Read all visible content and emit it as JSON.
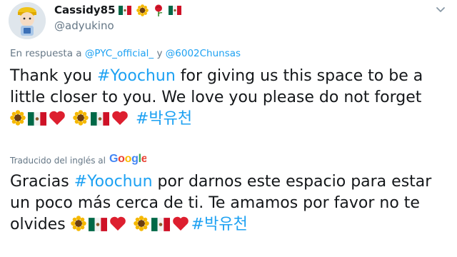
{
  "user": {
    "display_name": "Cassidy85",
    "handle": "@adyukino",
    "name_emojis": [
      "flag-mexico-icon",
      "sunflower-icon",
      "rose-icon",
      "flag-mexico-icon"
    ]
  },
  "reply": {
    "prefix": "En respuesta a",
    "mention_1": "@PYC_official_",
    "connector": "y",
    "mention_2": "@6002Chunsas"
  },
  "tweet": {
    "text_before": "Thank you ",
    "hashtag_1": "#Yoochun",
    "text_after": " for giving us this space to be a little closer to you. We love you please do not forget",
    "hashtag_2": "#박유천"
  },
  "translation": {
    "label": "Traducido del inglés al",
    "provider": "Google",
    "text_before": "Gracias ",
    "hashtag_1": "#Yoochun",
    "text_after": " por darnos este espacio para estar un poco más cerca de ti. Te amamos por favor no te olvides",
    "hashtag_2": "#박유천"
  },
  "colors": {
    "link": "#1da1f2",
    "secondary_text": "#657786",
    "primary_text": "#14171a"
  }
}
